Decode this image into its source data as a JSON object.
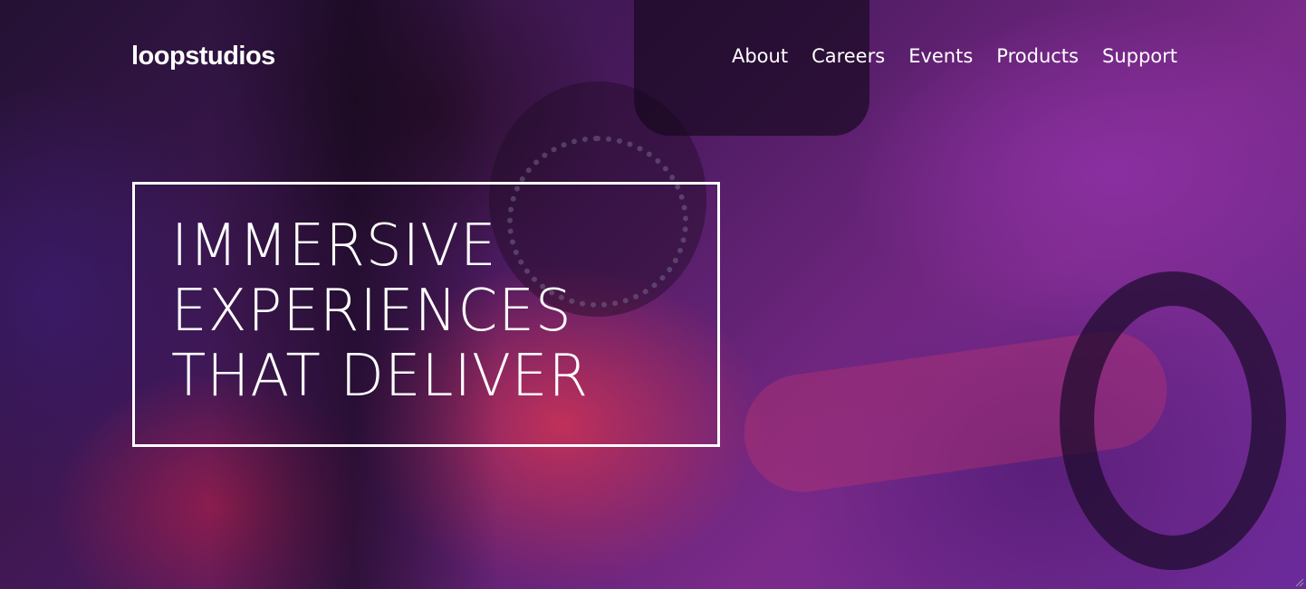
{
  "header": {
    "logo": "loopstudios",
    "nav": [
      {
        "label": "About"
      },
      {
        "label": "Careers"
      },
      {
        "label": "Events"
      },
      {
        "label": "Products"
      },
      {
        "label": "Support"
      }
    ]
  },
  "hero": {
    "headline_lines": [
      "IMMERSIVE",
      "EXPERIENCES",
      "THAT DELIVER"
    ],
    "background_image": "vr-racing-player-photo"
  },
  "colors": {
    "text": "#ffffff",
    "overlay_purple": "#7b2a8a",
    "overlay_dark": "#140a1f",
    "accent_magenta": "#c0305a"
  },
  "icons": {
    "resize_grip": "resize-grip-icon"
  }
}
